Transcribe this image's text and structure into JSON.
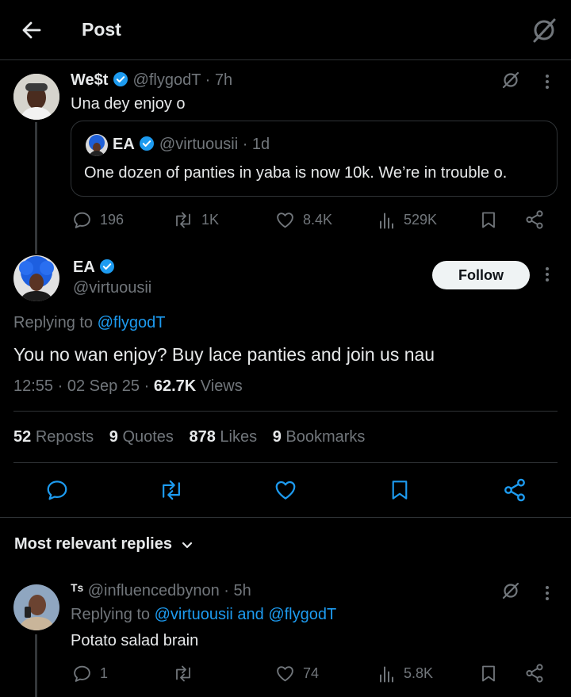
{
  "header": {
    "title": "Post"
  },
  "parent_post": {
    "display_name": "We$t",
    "handle": "@flygodT",
    "time": "7h",
    "text": "Una dey enjoy o",
    "quote": {
      "display_name": "EA",
      "handle": "@virtuousii",
      "time": "1d",
      "text": "One dozen of panties in yaba is now 10k. We’re in trouble o."
    },
    "actions": {
      "replies": "196",
      "reposts": "1K",
      "likes": "8.4K",
      "views": "529K"
    }
  },
  "main_post": {
    "display_name": "EA",
    "handle": "@virtuousii",
    "follow_label": "Follow",
    "replying_prefix": "Replying to",
    "replying_to": "@flygodT",
    "text": "You no wan enjoy? Buy lace panties and join us nau",
    "time": "12:55",
    "date": "02 Sep 25",
    "views_count": "62.7K",
    "views_label": "Views",
    "stats": {
      "reposts_count": "52",
      "reposts_label": "Reposts",
      "quotes_count": "9",
      "quotes_label": "Quotes",
      "likes_count": "878",
      "likes_label": "Likes",
      "bookmarks_count": "9",
      "bookmarks_label": "Bookmarks"
    }
  },
  "replies_filter": {
    "label": "Most relevant replies"
  },
  "reply": {
    "display_name": "ᵀˢ",
    "handle": "@influencedbynon",
    "time": "5h",
    "replying_prefix": "Replying to",
    "replying_to": "@virtuousii and @flygodT",
    "text": "Potato salad brain",
    "actions": {
      "replies": "1",
      "likes": "74",
      "views": "5.8K"
    }
  },
  "colors": {
    "accent": "#1d9bf0",
    "muted": "#71767b",
    "text": "#e7e9ea",
    "border": "#2f3336",
    "background": "#000000"
  }
}
